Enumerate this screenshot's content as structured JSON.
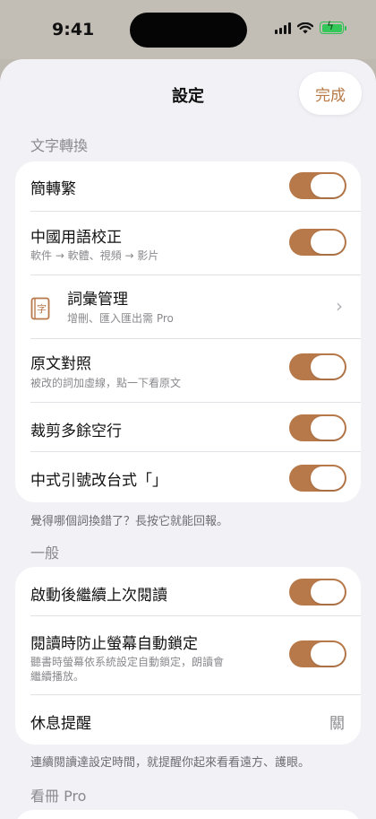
{
  "status": {
    "time": "9:41"
  },
  "header": {
    "title": "設定",
    "done_label": "完成"
  },
  "sections": {
    "conversion": {
      "title": "文字轉換",
      "rows": [
        {
          "title": "簡轉繁",
          "toggle": true
        },
        {
          "title": "中國用語校正",
          "subtitle": "軟件 → 軟體、視頻 → 影片",
          "toggle": true
        },
        {
          "title": "詞彙管理",
          "subtitle": "增刪、匯入匯出需 Pro",
          "icon": "book-icon",
          "icon_glyph": "字"
        },
        {
          "title": "原文對照",
          "subtitle": "被改的詞加虛線，點一下看原文",
          "toggle": true
        },
        {
          "title": "裁剪多餘空行",
          "toggle": true
        },
        {
          "title": "中式引號改台式「」",
          "toggle": true
        }
      ],
      "footer": "覺得哪個詞換錯了？長按它就能回報。"
    },
    "general": {
      "title": "一般",
      "rows": [
        {
          "title": "啟動後繼續上次閱讀",
          "toggle": true
        },
        {
          "title": "閱讀時防止螢幕自動鎖定",
          "subtitle_line1": "聽書時螢幕依系統設定自動鎖定，朗讀會",
          "subtitle_line2": "繼續播放。",
          "toggle": true
        },
        {
          "title": "休息提醒",
          "value": "關"
        }
      ],
      "footer": "連續閱讀達設定時間，就提醒你起來看看遠方、護眼。"
    },
    "pro": {
      "title": "看冊 Pro"
    }
  },
  "colors": {
    "accent": "#b8794a",
    "background": "#f2f1f6"
  }
}
